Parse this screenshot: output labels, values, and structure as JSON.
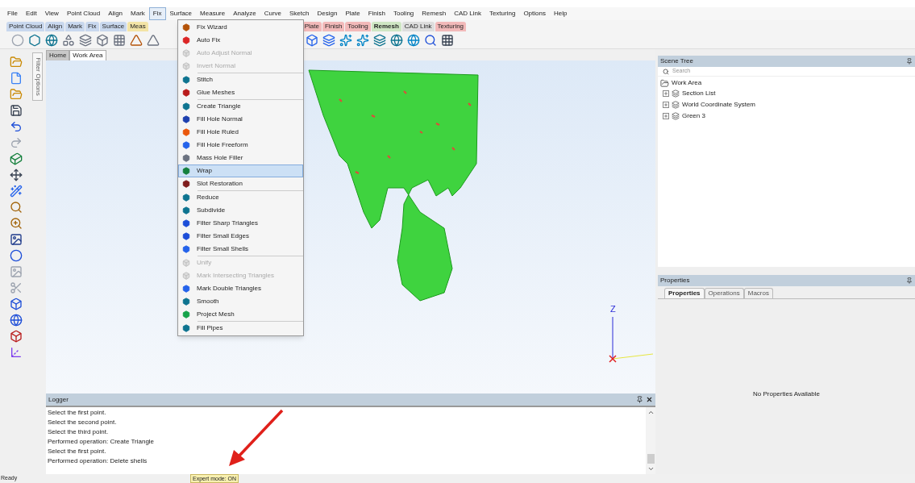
{
  "menu_bar": [
    {
      "label": "File",
      "selected": false
    },
    {
      "label": "Edit",
      "selected": false
    },
    {
      "label": "View",
      "selected": false
    },
    {
      "label": "Point Cloud",
      "selected": false
    },
    {
      "label": "Align",
      "selected": false
    },
    {
      "label": "Mark",
      "selected": false
    },
    {
      "label": "Fix",
      "selected": true
    },
    {
      "label": "Surface",
      "selected": false
    },
    {
      "label": "Measure",
      "selected": false
    },
    {
      "label": "Analyze",
      "selected": false
    },
    {
      "label": "Curve",
      "selected": false
    },
    {
      "label": "Sketch",
      "selected": false
    },
    {
      "label": "Design",
      "selected": false
    },
    {
      "label": "Plate",
      "selected": false
    },
    {
      "label": "Finish",
      "selected": false
    },
    {
      "label": "Tooling",
      "selected": false
    },
    {
      "label": "Remesh",
      "selected": false
    },
    {
      "label": "CAD Link",
      "selected": false
    },
    {
      "label": "Texturing",
      "selected": false
    },
    {
      "label": "Options",
      "selected": false
    },
    {
      "label": "Help",
      "selected": false
    }
  ],
  "ribbon_tabs_left": [
    {
      "label": "Point Cloud",
      "color": "#c9d8ee",
      "selected": false
    },
    {
      "label": "Align",
      "color": "#c9d8ee",
      "selected": false
    },
    {
      "label": "Mark",
      "color": "#c9d8ee",
      "selected": false
    },
    {
      "label": "Fix",
      "color": "#c9d8ee",
      "selected": false
    },
    {
      "label": "Surface",
      "color": "#c9d8ee",
      "selected": false
    },
    {
      "label": "Meas",
      "color": "#f3e4a6",
      "selected": false
    }
  ],
  "ribbon_tabs_right": [
    {
      "label": "Plate",
      "color": "#f2b9b9",
      "selected": false
    },
    {
      "label": "Finish",
      "color": "#f2b9b9",
      "selected": false
    },
    {
      "label": "Tooling",
      "color": "#f2b9b9",
      "selected": false
    },
    {
      "label": "Remesh",
      "color": "#cfe6c4",
      "selected": true
    },
    {
      "label": "CAD Link",
      "color": "#dddddd",
      "selected": false
    },
    {
      "label": "Texturing",
      "color": "#f2b9b9",
      "selected": false
    }
  ],
  "fix_menu": [
    [
      {
        "label": "Fix Wizard",
        "disabled": false,
        "selected": false
      },
      {
        "label": "Auto Fix",
        "disabled": false,
        "selected": false
      },
      {
        "label": "Auto Adjust Normal",
        "disabled": true,
        "selected": false
      },
      {
        "label": "Invert Normal",
        "disabled": true,
        "selected": false
      }
    ],
    [
      {
        "label": "Stitch",
        "disabled": false,
        "selected": false
      },
      {
        "label": "Glue Meshes",
        "disabled": false,
        "selected": false
      }
    ],
    [
      {
        "label": "Create Triangle",
        "disabled": false,
        "selected": false
      },
      {
        "label": "Fill Hole Normal",
        "disabled": false,
        "selected": false
      },
      {
        "label": "Fill Hole Ruled",
        "disabled": false,
        "selected": false
      },
      {
        "label": "Fill Hole Freeform",
        "disabled": false,
        "selected": false
      },
      {
        "label": "Mass Hole Filler",
        "disabled": false,
        "selected": false
      },
      {
        "label": "Wrap",
        "disabled": false,
        "selected": true
      },
      {
        "label": "Slot Restoration",
        "disabled": false,
        "selected": false
      }
    ],
    [
      {
        "label": "Reduce",
        "disabled": false,
        "selected": false
      },
      {
        "label": "Subdivide",
        "disabled": false,
        "selected": false
      },
      {
        "label": "Filter Sharp Triangles",
        "disabled": false,
        "selected": false
      },
      {
        "label": "Filter Small Edges",
        "disabled": false,
        "selected": false
      },
      {
        "label": "Filter Small Shells",
        "disabled": false,
        "selected": false
      }
    ],
    [
      {
        "label": "Unify",
        "disabled": true,
        "selected": false
      },
      {
        "label": "Mark Intersecting Triangles",
        "disabled": true,
        "selected": false
      },
      {
        "label": "Mark Double Triangles",
        "disabled": false,
        "selected": false
      },
      {
        "label": "Smooth",
        "disabled": false,
        "selected": false
      },
      {
        "label": "Project Mesh",
        "disabled": false,
        "selected": false
      }
    ],
    [
      {
        "label": "Fill Pipes",
        "disabled": false,
        "selected": false
      }
    ]
  ],
  "side_tab": "Filter Options",
  "view_tabs": [
    {
      "label": "Home",
      "selected": false
    },
    {
      "label": "Work Area",
      "selected": true
    }
  ],
  "axis_label": "Z",
  "logger": {
    "title": "Logger",
    "lines": [
      "Select the first point.",
      "Select the second point.",
      "Select the third point.",
      "Performed operation: Create Triangle",
      "Select the first point.",
      "Performed operation: Delete shells"
    ]
  },
  "scene_tree": {
    "title": "Scene Tree",
    "search": {
      "placeholder": "Search"
    },
    "root": {
      "label": "Work Area",
      "children": [
        {
          "label": "Section List",
          "expanded": false
        },
        {
          "label": "World Coordinate System",
          "expanded": false
        },
        {
          "label": "Green 3",
          "expanded": false
        }
      ]
    }
  },
  "properties": {
    "title": "Properties",
    "tabs": [
      {
        "label": "Properties",
        "selected": true
      },
      {
        "label": "Operations",
        "selected": false
      },
      {
        "label": "Macros",
        "selected": false
      }
    ],
    "message": "No Properties Available"
  },
  "status_bar": {
    "text": "Ready",
    "mode": "Expert mode: ON"
  }
}
